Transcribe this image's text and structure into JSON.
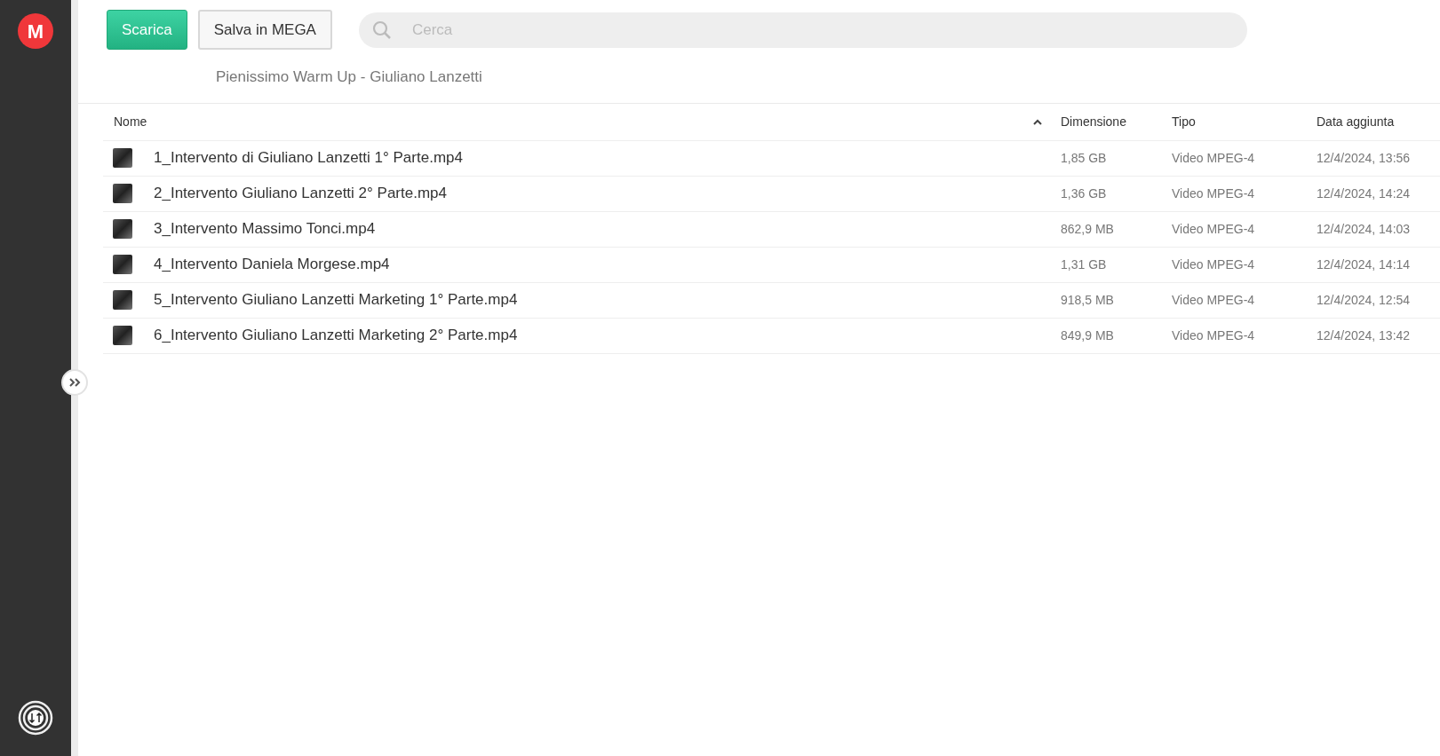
{
  "sidebar": {
    "logo": "M"
  },
  "toolbar": {
    "buttons": [
      {
        "label": "Scarica",
        "kind": "primary"
      },
      {
        "label": "Salva in MEGA",
        "kind": "secondary"
      }
    ],
    "search": {
      "placeholder": "Cerca"
    }
  },
  "folder_title": "Pienissimo Warm Up - Giuliano Lanzetti",
  "table": {
    "columns": [
      {
        "label": "Nome",
        "sort_ascending": true
      },
      {
        "label": "Dimensione"
      },
      {
        "label": "Tipo"
      },
      {
        "label": "Data aggiunta"
      }
    ],
    "rows": [
      {
        "name": "1_Intervento di Giuliano Lanzetti 1° Parte.mp4",
        "size": "1,85 GB",
        "type": "Video MPEG-4",
        "date": "12/4/2024, 13:56"
      },
      {
        "name": "2_Intervento Giuliano Lanzetti 2° Parte.mp4",
        "size": "1,36 GB",
        "type": "Video MPEG-4",
        "date": "12/4/2024, 14:24"
      },
      {
        "name": "3_Intervento Massimo Tonci.mp4",
        "size": "862,9 MB",
        "type": "Video MPEG-4",
        "date": "12/4/2024, 14:03"
      },
      {
        "name": "4_Intervento Daniela Morgese.mp4",
        "size": "1,31 GB",
        "type": "Video MPEG-4",
        "date": "12/4/2024, 14:14"
      },
      {
        "name": "5_Intervento Giuliano Lanzetti Marketing 1° Parte.mp4",
        "size": "918,5 MB",
        "type": "Video MPEG-4",
        "date": "12/4/2024, 12:54"
      },
      {
        "name": "6_Intervento Giuliano Lanzetti Marketing 2° Parte.mp4",
        "size": "849,9 MB",
        "type": "Video MPEG-4",
        "date": "12/4/2024, 13:42"
      }
    ]
  }
}
